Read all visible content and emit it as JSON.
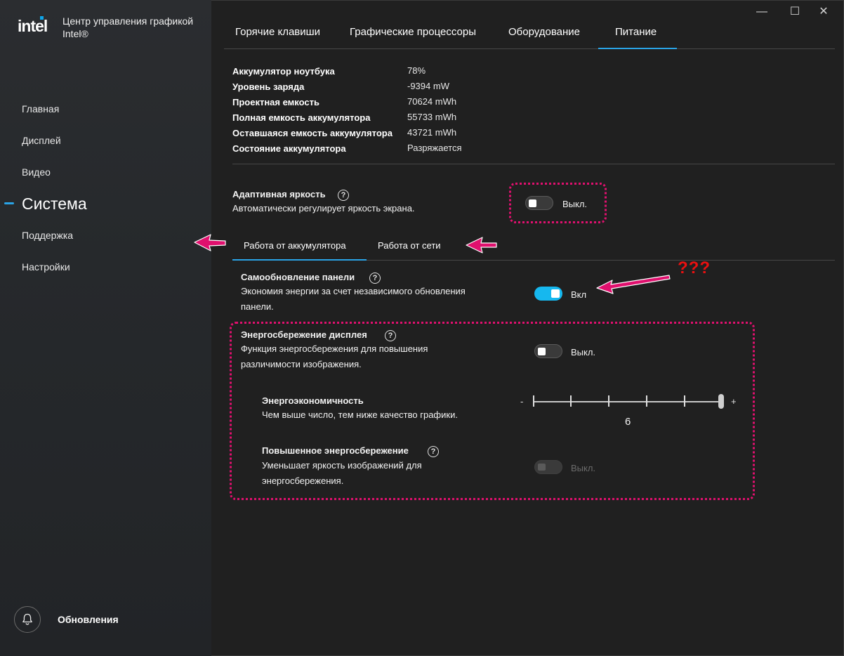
{
  "app": {
    "logo": "intel",
    "title_line1": "Центр управления графикой",
    "title_line2": "Intel®"
  },
  "window_controls": {
    "minimize": "—",
    "maximize": "☐",
    "close": "✕"
  },
  "sidebar": {
    "items": [
      {
        "label": "Главная"
      },
      {
        "label": "Дисплей"
      },
      {
        "label": "Видео"
      },
      {
        "label": "Система",
        "active": true
      },
      {
        "label": "Поддержка"
      },
      {
        "label": "Настройки"
      }
    ],
    "updates_label": "Обновления",
    "updates_icon": "bell-icon"
  },
  "top_tabs": [
    {
      "label": "Горячие клавиши"
    },
    {
      "label": "Графические процессоры"
    },
    {
      "label": "Оборудование"
    },
    {
      "label": "Питание",
      "active": true
    }
  ],
  "battery_info": [
    {
      "label": "Аккумулятор ноутбука",
      "value": "78%"
    },
    {
      "label": "Уровень заряда",
      "value": "-9394 mW"
    },
    {
      "label": "Проектная емкость",
      "value": "70624 mWh"
    },
    {
      "label": "Полная емкость аккумулятора",
      "value": "55733 mWh"
    },
    {
      "label": "Оставшаяся емкость аккумулятора",
      "value": "43721 mWh"
    },
    {
      "label": "Состояние аккумулятора",
      "value": "Разряжается"
    }
  ],
  "adaptive_brightness": {
    "title": "Адаптивная яркость",
    "description": "Автоматически регулирует яркость экрана.",
    "state": false,
    "state_label": "Выкл."
  },
  "sub_tabs": [
    {
      "label": "Работа от аккумулятора",
      "active": true
    },
    {
      "label": "Работа от сети"
    }
  ],
  "panel_self_refresh": {
    "title": "Самообновление панели",
    "description_line1": "Экономия энергии за счет независимого обновления",
    "description_line2": "панели.",
    "state": true,
    "state_label": "Вкл"
  },
  "display_power_saving": {
    "title": "Энергосбережение дисплея",
    "description_line1": "Функция энергосбережения для повышения",
    "description_line2": "различимости изображения.",
    "state": false,
    "state_label": "Выкл."
  },
  "power_efficiency": {
    "title": "Энергоэкономичность",
    "description": "Чем выше число, тем ниже качество графики.",
    "min_sign": "-",
    "max_sign": "+",
    "value": "6",
    "level_fraction": 1.0
  },
  "enhanced_power_saving": {
    "title": "Повышенное энергосбережение",
    "description_line1": "Уменьшает яркость изображений для",
    "description_line2": "энергосбережения.",
    "state": false,
    "disabled": true,
    "state_label": "Выкл."
  },
  "annotation": {
    "text": "???",
    "color": "#e0106e",
    "text_color": "#ea1010"
  },
  "colors": {
    "accent": "#2aa4e6",
    "toggle_on": "#16b8ef",
    "background": "#202020"
  }
}
